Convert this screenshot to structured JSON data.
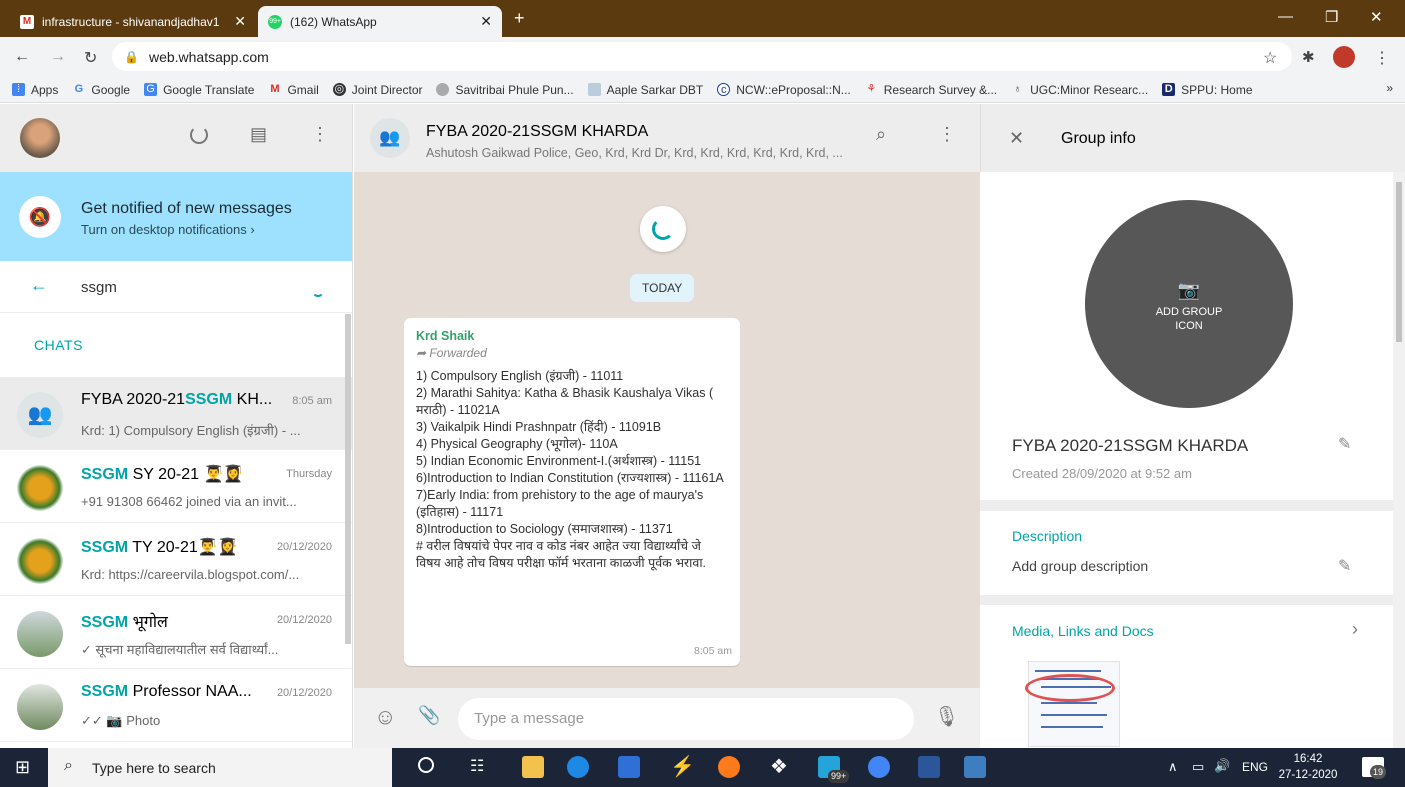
{
  "browser": {
    "tabs": [
      {
        "title": "infrastructure - shivanandjadhav1",
        "active": false,
        "icon": "gmail-icon"
      },
      {
        "title": "(162) WhatsApp",
        "active": true,
        "icon": "whatsapp-icon",
        "badge": "99+"
      }
    ],
    "url": "web.whatsapp.com",
    "bookmarks": [
      {
        "label": "Apps",
        "icon": "apps-grid-icon"
      },
      {
        "label": "Google",
        "icon": "google-icon"
      },
      {
        "label": "Google Translate",
        "icon": "translate-icon"
      },
      {
        "label": "Gmail",
        "icon": "gmail-icon"
      },
      {
        "label": "Joint Director",
        "icon": "globe-icon"
      },
      {
        "label": "Savitribai Phule Pun...",
        "icon": "university-icon"
      },
      {
        "label": "Aaple Sarkar DBT",
        "icon": "doc-icon"
      },
      {
        "label": "NCW::eProposal::N...",
        "icon": "ncw-icon"
      },
      {
        "label": "Research Survey &...",
        "icon": "survey-icon"
      },
      {
        "label": "UGC:Minor Researc...",
        "icon": "ugc-icon"
      },
      {
        "label": "SPPU: Home",
        "icon": "sppu-icon"
      }
    ],
    "overflow": "»"
  },
  "left": {
    "notification": {
      "title": "Get notified of new messages",
      "action": "Turn on desktop notifications ›"
    },
    "search_value": "ssgm",
    "section_label": "CHATS",
    "chats": [
      {
        "name_prefix": "FYBA 2020-21",
        "name_highlight": "SSGM",
        "name_suffix": " KH...",
        "time": "8:05 am",
        "preview": "Krd: 1) Compulsory English (इंग्रजी) - ...",
        "selected": true
      },
      {
        "name_prefix": "",
        "name_highlight": "SSGM",
        "name_suffix": " SY 20-21 👨‍🎓👩‍🎓",
        "time": "Thursday",
        "preview": "+91 91308 66462 joined via an invit...",
        "selected": false
      },
      {
        "name_prefix": "",
        "name_highlight": "SSGM",
        "name_suffix": " TY 20-21👨‍🎓👩‍🎓",
        "time": "20/12/2020",
        "preview": "Krd: https://careervila.blogspot.com/...",
        "selected": false
      },
      {
        "name_prefix": "",
        "name_highlight": "SSGM",
        "name_suffix": " भूगोल",
        "time": "20/12/2020",
        "preview": "✓ सूचना महाविद्यालयातील सर्व विद्यार्थ्यां...",
        "selected": false
      },
      {
        "name_prefix": "",
        "name_highlight": "SSGM",
        "name_suffix": " Professor NAA...",
        "time": "20/12/2020",
        "preview": "✓✓ 📷 Photo",
        "selected": false
      }
    ]
  },
  "chat": {
    "title": "FYBA 2020-21SSGM KHARDA",
    "subtitle": "Ashutosh Gaikwad Police, Geo, Krd, Krd Dr, Krd, Krd, Krd, Krd, Krd, Krd, ...",
    "date_chip": "TODAY",
    "message": {
      "sender": "Krd Shaik",
      "forwarded": "Forwarded",
      "lines": [
        "1) Compulsory English (इंग्रजी) - 11011",
        "2) Marathi Sahitya: Katha & Bhasik Kaushalya Vikas ( मराठी) - 11021A",
        "3) Vaikalpik Hindi Prashnpatr (हिंदी) - 11091B",
        "4) Physical Geography (भूगोल)- 110A",
        "5) Indian Economic Environment-I.(अर्थशास्त्र) - 11151",
        "6)Introduction to Indian Constitution (राज्यशास्त्र) - 11161A",
        "7)Early India: from prehistory to the age of maurya's (इतिहास) - 11171",
        "8)Introduction to Sociology (समाजशास्त्र) - 11371",
        "# वरील विषयांचे पेपर नाव व कोड नंबर आहेत ज्या विद्यार्थ्यांचे जे विषय आहे तोच विषय परीक्षा फॉर्म भरताना काळजी पूर्वक भरावा."
      ],
      "time": "8:05 am"
    },
    "composer_placeholder": "Type a message"
  },
  "group_info": {
    "header": "Group info",
    "add_icon_label": "ADD GROUP ICON",
    "name": "FYBA 2020-21SSGM KHARDA",
    "created": "Created 28/09/2020 at 9:52 am",
    "description_label": "Description",
    "description_placeholder": "Add group description",
    "media_label": "Media, Links and Docs"
  },
  "taskbar": {
    "search_placeholder": "Type here to search",
    "tray_lang": "ENG",
    "time": "16:42",
    "date": "27-12-2020",
    "notification_count": "19",
    "app_badge": "99+"
  },
  "colors": {
    "accent": "#00a5a8",
    "notif_bg": "#9de1fe",
    "chat_bg": "#e5ddd5",
    "tabbar": "#5a3a0e"
  }
}
